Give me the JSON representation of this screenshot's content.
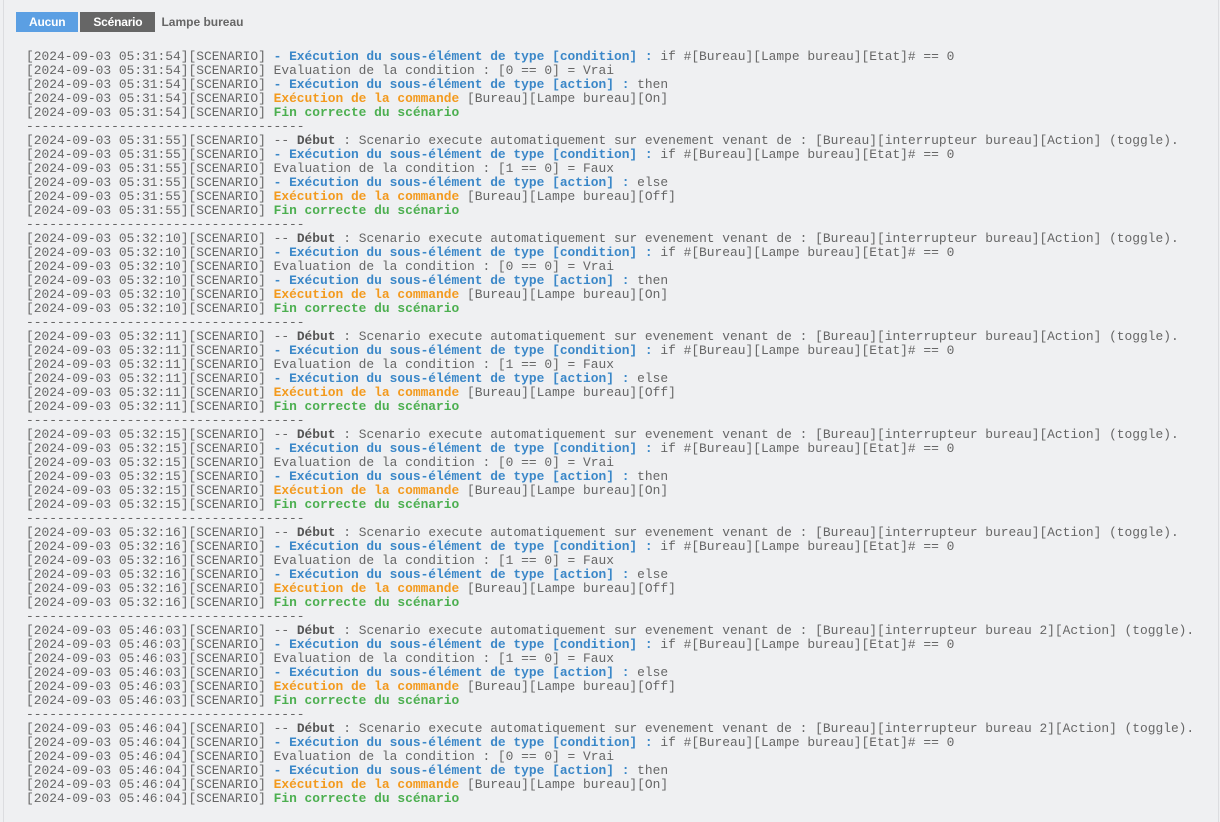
{
  "toolbar": {
    "btn_none": "Aucun",
    "btn_scenario": "Scénario",
    "breadcrumb": "Lampe bureau"
  },
  "colors": {
    "blue": "#3a87c8",
    "orange": "#f39a1e",
    "green": "#4caf50",
    "button_blue": "#5b9fe3",
    "button_gray": "#666666"
  },
  "separator": "------------------------------------",
  "log_tag": "[SCENARIO]",
  "blocks": [
    {
      "time": "2024-09-03 05:31:54",
      "lines": [
        {
          "type": "cond",
          "label": "- Exécution du sous-élément de type [condition] :",
          "text": " if #[Bureau][Lampe bureau][Etat]# == 0"
        },
        {
          "type": "eval",
          "label": "",
          "text": "Evaluation de la condition : [0 == 0] = Vrai"
        },
        {
          "type": "action",
          "label": "- Exécution du sous-élément de type [action] :",
          "text": " then"
        },
        {
          "type": "cmd",
          "label": "Exécution de la commande",
          "text": " [Bureau][Lampe bureau][On]"
        },
        {
          "type": "end",
          "label": "Fin correcte du scénario",
          "text": ""
        }
      ]
    },
    {
      "time": "2024-09-03 05:31:55",
      "lines": [
        {
          "type": "debut",
          "label": "Début",
          "pre": "-- ",
          "text": " : Scenario execute automatiquement sur evenement venant de : [Bureau][interrupteur bureau][Action] (toggle)."
        },
        {
          "type": "cond",
          "label": "- Exécution du sous-élément de type [condition] :",
          "text": " if #[Bureau][Lampe bureau][Etat]# == 0"
        },
        {
          "type": "eval",
          "label": "",
          "text": "Evaluation de la condition : [1 == 0] = Faux"
        },
        {
          "type": "action",
          "label": "- Exécution du sous-élément de type [action] :",
          "text": " else"
        },
        {
          "type": "cmd",
          "label": "Exécution de la commande",
          "text": " [Bureau][Lampe bureau][Off]"
        },
        {
          "type": "end",
          "label": "Fin correcte du scénario",
          "text": ""
        }
      ]
    },
    {
      "time": "2024-09-03 05:32:10",
      "lines": [
        {
          "type": "debut",
          "label": "Début",
          "pre": "-- ",
          "text": " : Scenario execute automatiquement sur evenement venant de : [Bureau][interrupteur bureau][Action] (toggle)."
        },
        {
          "type": "cond",
          "label": "- Exécution du sous-élément de type [condition] :",
          "text": " if #[Bureau][Lampe bureau][Etat]# == 0"
        },
        {
          "type": "eval",
          "label": "",
          "text": "Evaluation de la condition : [0 == 0] = Vrai"
        },
        {
          "type": "action",
          "label": "- Exécution du sous-élément de type [action] :",
          "text": " then"
        },
        {
          "type": "cmd",
          "label": "Exécution de la commande",
          "text": " [Bureau][Lampe bureau][On]"
        },
        {
          "type": "end",
          "label": "Fin correcte du scénario",
          "text": ""
        }
      ]
    },
    {
      "time": "2024-09-03 05:32:11",
      "lines": [
        {
          "type": "debut",
          "label": "Début",
          "pre": "-- ",
          "text": " : Scenario execute automatiquement sur evenement venant de : [Bureau][interrupteur bureau][Action] (toggle)."
        },
        {
          "type": "cond",
          "label": "- Exécution du sous-élément de type [condition] :",
          "text": " if #[Bureau][Lampe bureau][Etat]# == 0"
        },
        {
          "type": "eval",
          "label": "",
          "text": "Evaluation de la condition : [1 == 0] = Faux"
        },
        {
          "type": "action",
          "label": "- Exécution du sous-élément de type [action] :",
          "text": " else"
        },
        {
          "type": "cmd",
          "label": "Exécution de la commande",
          "text": " [Bureau][Lampe bureau][Off]"
        },
        {
          "type": "end",
          "label": "Fin correcte du scénario",
          "text": ""
        }
      ]
    },
    {
      "time": "2024-09-03 05:32:15",
      "lines": [
        {
          "type": "debut",
          "label": "Début",
          "pre": "-- ",
          "text": " : Scenario execute automatiquement sur evenement venant de : [Bureau][interrupteur bureau][Action] (toggle)."
        },
        {
          "type": "cond",
          "label": "- Exécution du sous-élément de type [condition] :",
          "text": " if #[Bureau][Lampe bureau][Etat]# == 0"
        },
        {
          "type": "eval",
          "label": "",
          "text": "Evaluation de la condition : [0 == 0] = Vrai"
        },
        {
          "type": "action",
          "label": "- Exécution du sous-élément de type [action] :",
          "text": " then"
        },
        {
          "type": "cmd",
          "label": "Exécution de la commande",
          "text": " [Bureau][Lampe bureau][On]"
        },
        {
          "type": "end",
          "label": "Fin correcte du scénario",
          "text": ""
        }
      ]
    },
    {
      "time": "2024-09-03 05:32:16",
      "lines": [
        {
          "type": "debut",
          "label": "Début",
          "pre": "-- ",
          "text": " : Scenario execute automatiquement sur evenement venant de : [Bureau][interrupteur bureau][Action] (toggle)."
        },
        {
          "type": "cond",
          "label": "- Exécution du sous-élément de type [condition] :",
          "text": " if #[Bureau][Lampe bureau][Etat]# == 0"
        },
        {
          "type": "eval",
          "label": "",
          "text": "Evaluation de la condition : [1 == 0] = Faux"
        },
        {
          "type": "action",
          "label": "- Exécution du sous-élément de type [action] :",
          "text": " else"
        },
        {
          "type": "cmd",
          "label": "Exécution de la commande",
          "text": " [Bureau][Lampe bureau][Off]"
        },
        {
          "type": "end",
          "label": "Fin correcte du scénario",
          "text": ""
        }
      ]
    },
    {
      "time": "2024-09-03 05:46:03",
      "lines": [
        {
          "type": "debut",
          "label": "Début",
          "pre": "-- ",
          "text": " : Scenario execute automatiquement sur evenement venant de : [Bureau][interrupteur bureau 2][Action] (toggle)."
        },
        {
          "type": "cond",
          "label": "- Exécution du sous-élément de type [condition] :",
          "text": " if #[Bureau][Lampe bureau][Etat]# == 0"
        },
        {
          "type": "eval",
          "label": "",
          "text": "Evaluation de la condition : [1 == 0] = Faux"
        },
        {
          "type": "action",
          "label": "- Exécution du sous-élément de type [action] :",
          "text": " else"
        },
        {
          "type": "cmd",
          "label": "Exécution de la commande",
          "text": " [Bureau][Lampe bureau][Off]"
        },
        {
          "type": "end",
          "label": "Fin correcte du scénario",
          "text": ""
        }
      ]
    },
    {
      "time": "2024-09-03 05:46:04",
      "lines": [
        {
          "type": "debut",
          "label": "Début",
          "pre": "-- ",
          "text": " : Scenario execute automatiquement sur evenement venant de : [Bureau][interrupteur bureau 2][Action] (toggle)."
        },
        {
          "type": "cond",
          "label": "- Exécution du sous-élément de type [condition] :",
          "text": " if #[Bureau][Lampe bureau][Etat]# == 0"
        },
        {
          "type": "eval",
          "label": "",
          "text": "Evaluation de la condition : [0 == 0] = Vrai"
        },
        {
          "type": "action",
          "label": "- Exécution du sous-élément de type [action] :",
          "text": " then"
        },
        {
          "type": "cmd",
          "label": "Exécution de la commande",
          "text": " [Bureau][Lampe bureau][On]"
        },
        {
          "type": "end",
          "label": "Fin correcte du scénario",
          "text": ""
        }
      ]
    }
  ]
}
